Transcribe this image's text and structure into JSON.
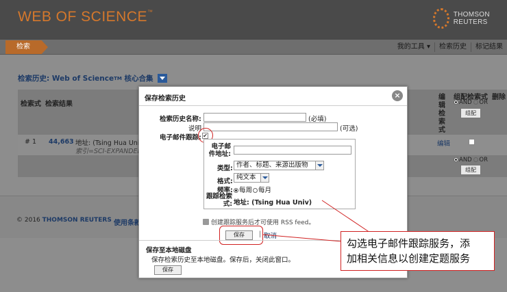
{
  "header": {
    "logo": "WEB OF SCIENCE",
    "logo_tm": "™",
    "brand": "THOMSON REUTERS"
  },
  "nav": {
    "search_tab": "检索",
    "my_tools": "我的工具 ▾",
    "search_history": "检索历史",
    "marked_list": "标记结果"
  },
  "history": {
    "title_prefix": "检索历史:",
    "title_db": "Web of Science",
    "title_tm": "TM",
    "title_suffix": "核心合集"
  },
  "table": {
    "col_set": "检索式",
    "col_results": "检索结果",
    "col_edit": "编辑检索式",
    "col_combine": "组配检索式",
    "col_delete": "删除",
    "and": "AND",
    "or": "OR",
    "combine_btn": "组配",
    "row": {
      "set": "# 1",
      "results": "44,663",
      "query": "地址: (Tsing Hua Univ)",
      "index": "索引=SCI-EXPANDED",
      "edit": "编辑"
    }
  },
  "footer": {
    "copyright": "© 2016",
    "brand": "THOMSON REUTERS",
    "link": "使用条款"
  },
  "modal": {
    "title": "保存检索历史",
    "close": "×",
    "name_label": "检索历史名称:",
    "name_required": "(必填)",
    "desc_label": "说明",
    "desc_optional": "(可选)",
    "email_alert_label": "电子邮件跟踪:",
    "email_label": "电子邮件地址:",
    "type_label": "类型:",
    "type_value": "作者、标题、来源出版物",
    "format_label": "格式:",
    "format_value": "纯文本",
    "freq_label": "频率:",
    "freq_weekly": "每周",
    "freq_monthly": "每月",
    "alert_query_label": "跟踪检索式:",
    "alert_query_value": "地址: (Tsing Hua Univ)",
    "rss_text": "创建跟踪服务后才可使用 RSS feed。",
    "save_btn": "保存",
    "cancel": "取消",
    "local_title": "保存至本地磁盘",
    "local_desc": "保存检索历史至本地磁盘。保存后，关闭此窗口。",
    "local_save_btn": "保存"
  },
  "callout": {
    "line1": "勾选电子邮件跟踪服务，添",
    "line2": "加相关信息以创建定题服务"
  }
}
